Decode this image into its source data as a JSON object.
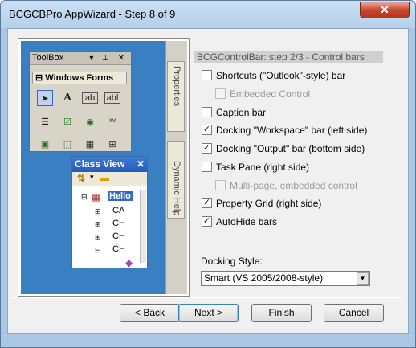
{
  "window": {
    "title": "BCGCBPro AppWizard - Step 8 of 9",
    "close_glyph": "✕"
  },
  "illustration": {
    "toolbox": {
      "title": "ToolBox",
      "title_icons": "▾ ⊥ ✕",
      "group": "Windows Forms",
      "tools": [
        "➤",
        "A",
        "ab",
        "abl",
        "☰",
        "☑",
        "◉",
        "xv",
        "▣",
        "⬚",
        "▦",
        "⊞"
      ]
    },
    "side_tabs": [
      "Properties",
      "Dynamic Help"
    ],
    "class_view": {
      "title": "Class View",
      "root": "Hello",
      "items": [
        "CA",
        "CH",
        "CH",
        "CH"
      ]
    }
  },
  "options": {
    "header": "BCGControlBar: step 2/3 - Control bars",
    "items": [
      {
        "label": "Shortcuts (\"Outlook\"-style) bar",
        "checked": false,
        "enabled": true
      },
      {
        "label": "Embedded Control",
        "checked": false,
        "enabled": false
      },
      {
        "label": "Caption bar",
        "checked": false,
        "enabled": true
      },
      {
        "label": "Docking \"Workspace\" bar (left side)",
        "checked": true,
        "enabled": true
      },
      {
        "label": "Docking \"Output\" bar (bottom side)",
        "checked": true,
        "enabled": true
      },
      {
        "label": "Task Pane (right side)",
        "checked": false,
        "enabled": true
      },
      {
        "label": "Multi-page, embedded control",
        "checked": false,
        "enabled": false
      },
      {
        "label": "Property Grid  (right side)",
        "checked": true,
        "enabled": true
      },
      {
        "label": "AutoHide bars",
        "checked": true,
        "enabled": true
      }
    ],
    "checkmark": "✓",
    "docking_style_label": "Docking Style:",
    "docking_style_value": "Smart (VS 2005/2008-style)",
    "dropdown_arrow": "▼"
  },
  "buttons": {
    "back": "< Back",
    "next": "Next >",
    "finish": "Finish",
    "cancel": "Cancel"
  }
}
